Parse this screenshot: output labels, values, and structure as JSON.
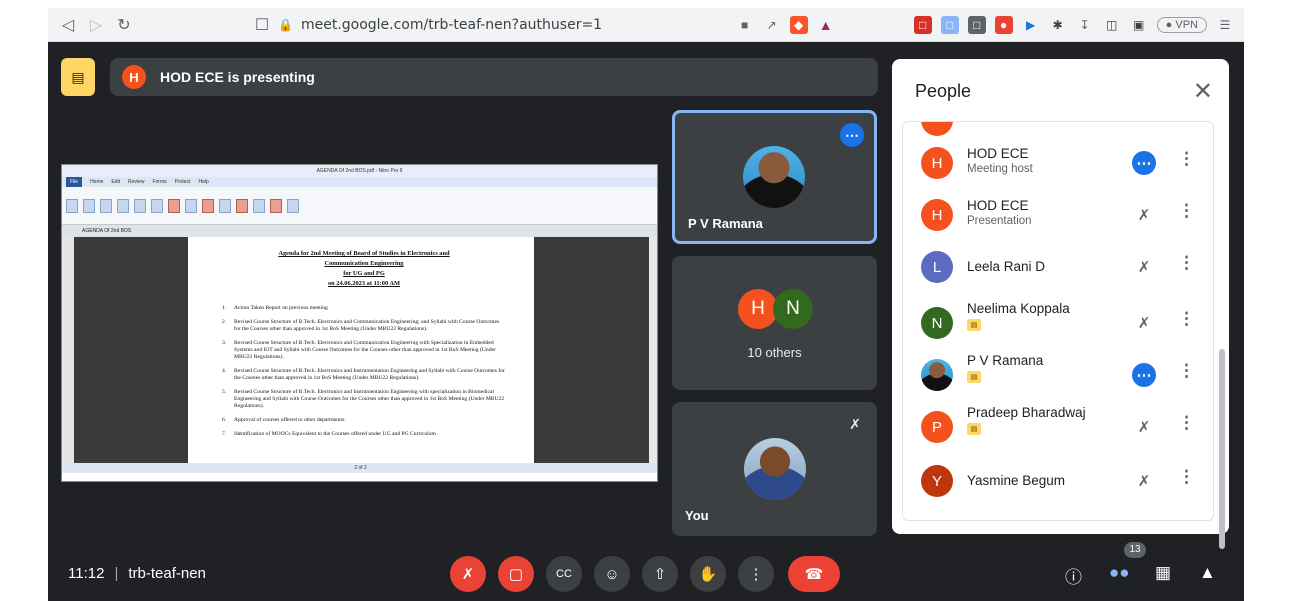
{
  "browser": {
    "url": "meet.google.com/trb-teaf-nen?authuser=1",
    "vpn_label": "● VPN",
    "nav_icons": [
      "back-icon",
      "forward-icon",
      "reload-icon",
      "bookmark-icon",
      "lock-icon"
    ]
  },
  "presenter": {
    "initial": "H",
    "text": "HOD ECE is presenting"
  },
  "shared_screen": {
    "window_title": "AGENDA Of 2nd BOS.pdf - Nitro Pro 9",
    "menu": [
      "File",
      "Home",
      "Edit",
      "Review",
      "Forms",
      "Protect",
      "Help"
    ],
    "tab_label": "AGENDA Of 2nd BOS",
    "status_text": "2 of 2",
    "title_lines": [
      "Agenda for 2nd Meeting of Board of Studies in Electronics and",
      "Communication Engineering",
      "for UG and PG",
      "on 24.06.2023 at 11:00 AM"
    ],
    "items": [
      {
        "num": "1.",
        "text": "Action Taken Report on previous meeting"
      },
      {
        "num": "2.",
        "text": "Revised Course Structure of B.Tech. Electronics and Communication Engineering; and Syllabi with Course Outcomes for the Courses other than approved in 1st BoS Meeting (Under MBU22 Regulations)."
      },
      {
        "num": "3.",
        "text": "Revised Course Structure of B.Tech. Electronics and Communication Engineering with Specialization in Embedded Systems and IOT and Syllabi with Course Outcomes for the Courses other than approved in 1st BoS Meeting (Under MBU22 Regulations)."
      },
      {
        "num": "4.",
        "text": "Revised Course Structure of B.Tech. Electronics and Instrumentation Engineering and Syllabi with Course Outcomes for the Courses other than approved in 1st BoS Meeting (Under MBU22 Regulations)."
      },
      {
        "num": "5.",
        "text": "Revised Course Structure of B.Tech. Electronics and Instrumentation Engineering with specialization in Biomedical Engineering and Syllabi with Course Outcomes for the Courses other than approved in 1st BoS Meeting (Under MBU22 Regulations)."
      },
      {
        "num": "6.",
        "text": "Approval of courses offered to other departments."
      },
      {
        "num": "7.",
        "text": "Identification of MOOCs Equivalent to the Courses offered under UG and PG Curriculum"
      }
    ]
  },
  "tiles": {
    "active_name": "P V Ramana",
    "others_initials": [
      "H",
      "N"
    ],
    "others_label": "10 others",
    "self_name": "You"
  },
  "people": {
    "title": "People",
    "rows": [
      {
        "initial": "H",
        "name": "HOD ECE",
        "sub": "Meeting host",
        "color": "#f4511e",
        "status": "more"
      },
      {
        "initial": "H",
        "name": "HOD ECE",
        "sub": "Presentation",
        "color": "#f4511e",
        "status": "muted-present"
      },
      {
        "initial": "L",
        "name": "Leela Rani D",
        "sub": "",
        "color": "#5c6bc0",
        "status": "muted"
      },
      {
        "initial": "N",
        "name": "Neelima Koppala",
        "sub": "",
        "color": "#33691e",
        "status": "muted"
      },
      {
        "initial": "",
        "name": "P V Ramana",
        "sub": "",
        "color": "#4fb3e8",
        "status": "more"
      },
      {
        "initial": "P",
        "name": "Pradeep Bharadwaj",
        "sub": "",
        "color": "#f4511e",
        "status": "muted"
      },
      {
        "initial": "Y",
        "name": "Yasmine Begum",
        "sub": "",
        "color": "#bf360c",
        "status": "muted"
      }
    ]
  },
  "bottom": {
    "time": "11:12",
    "meeting_code": "trb-teaf-nen",
    "participant_count": "13"
  }
}
